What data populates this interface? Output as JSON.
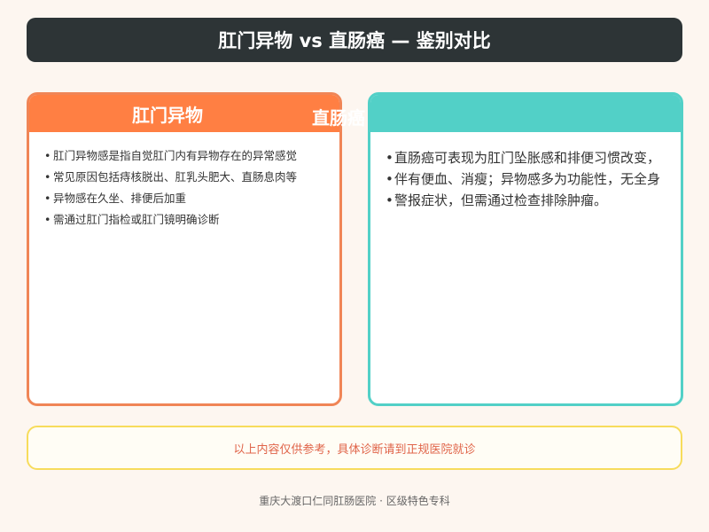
{
  "title": "肛门异物 vs 直肠癌 — 鉴别对比",
  "left_card": {
    "heading": "肛门异物",
    "items": [
      "肛门异物感是指自觉肛门内有异物存在的异常感觉",
      "常见原因包括痔核脱出、肛乳头肥大、直肠息肉等",
      "异物感在久坐、排便后加重",
      "需通过肛门指检或肛门镜明确诊断"
    ],
    "color": "#ff7f43"
  },
  "right_card": {
    "heading": "直肠癌",
    "items": [
      "直肠癌可表现为肛门坠胀感和排便习惯改变，",
      "伴有便血、消瘦；异物感多为功能性，无全身",
      "警报症状，但需通过检查排除肿瘤。"
    ],
    "color": "#52d0c7"
  },
  "notice": "以上内容仅供参考，具体诊断请到正规医院就诊",
  "footer": "重庆大渡口仁同肛肠医院 · 区级特色专科"
}
